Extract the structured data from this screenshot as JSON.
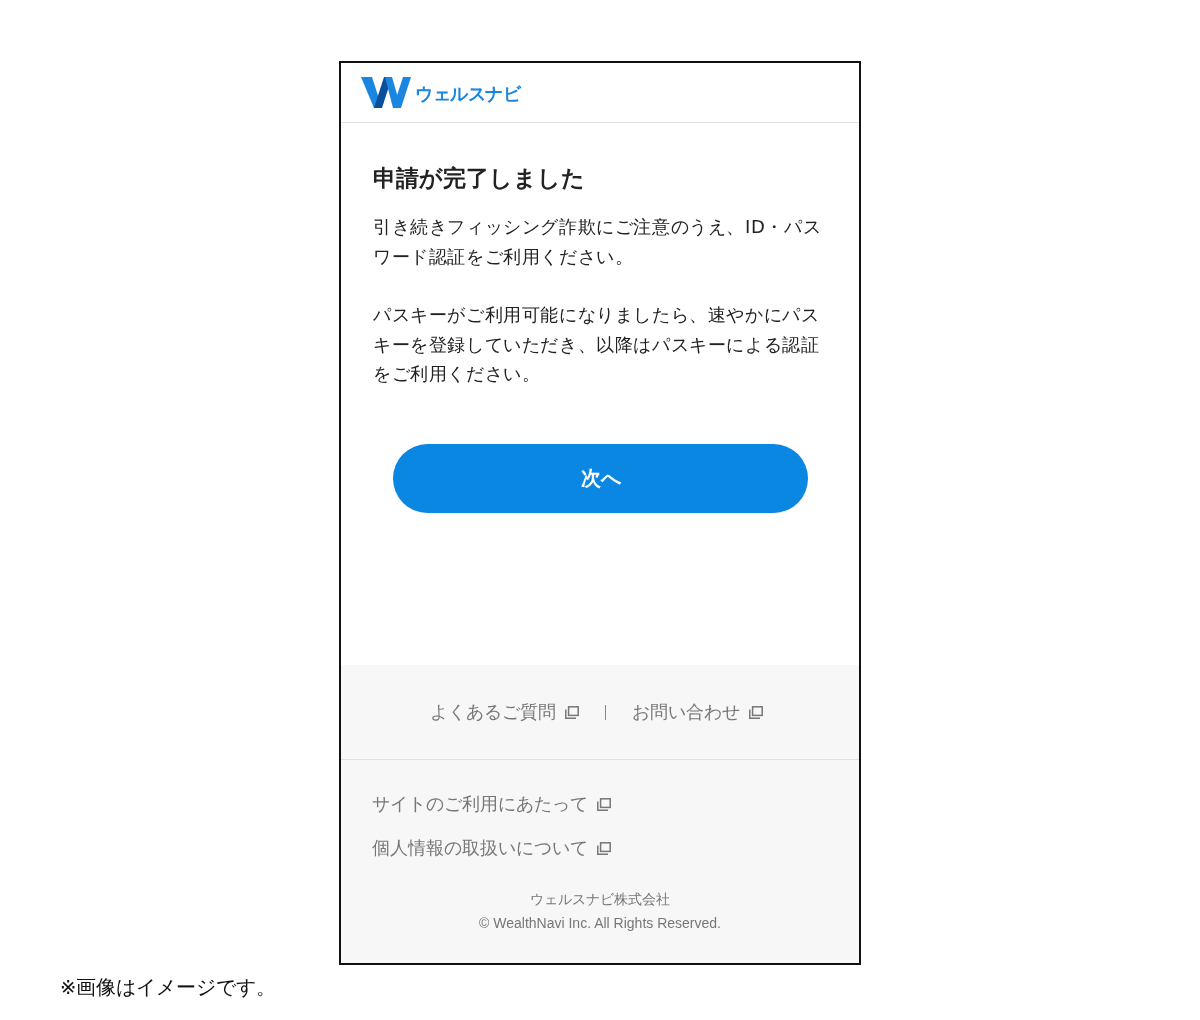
{
  "header": {
    "logo_text": "ウェルスナビ"
  },
  "content": {
    "title": "申請が完了しました",
    "paragraphs": [
      "引き続きフィッシング詐欺にご注意のうえ、ID・パスワード認証をご利用ください。",
      "パスキーがご利用可能になりましたら、速やかにパスキーを登録していただき、以降はパスキーによる認証をご利用ください。"
    ],
    "button": {
      "label": "次へ"
    }
  },
  "footer": {
    "top_links": [
      {
        "label": "よくあるご質問",
        "external": true
      },
      {
        "label": "お問い合わせ",
        "external": true
      }
    ],
    "links": [
      {
        "label": "サイトのご利用にあたって",
        "external": true
      },
      {
        "label": "個人情報の取扱いについて",
        "external": true
      }
    ],
    "company": "ウェルスナビ株式会社",
    "copyright": "© WealthNavi Inc. All Rights Reserved."
  },
  "note": "※画像はイメージです。"
}
